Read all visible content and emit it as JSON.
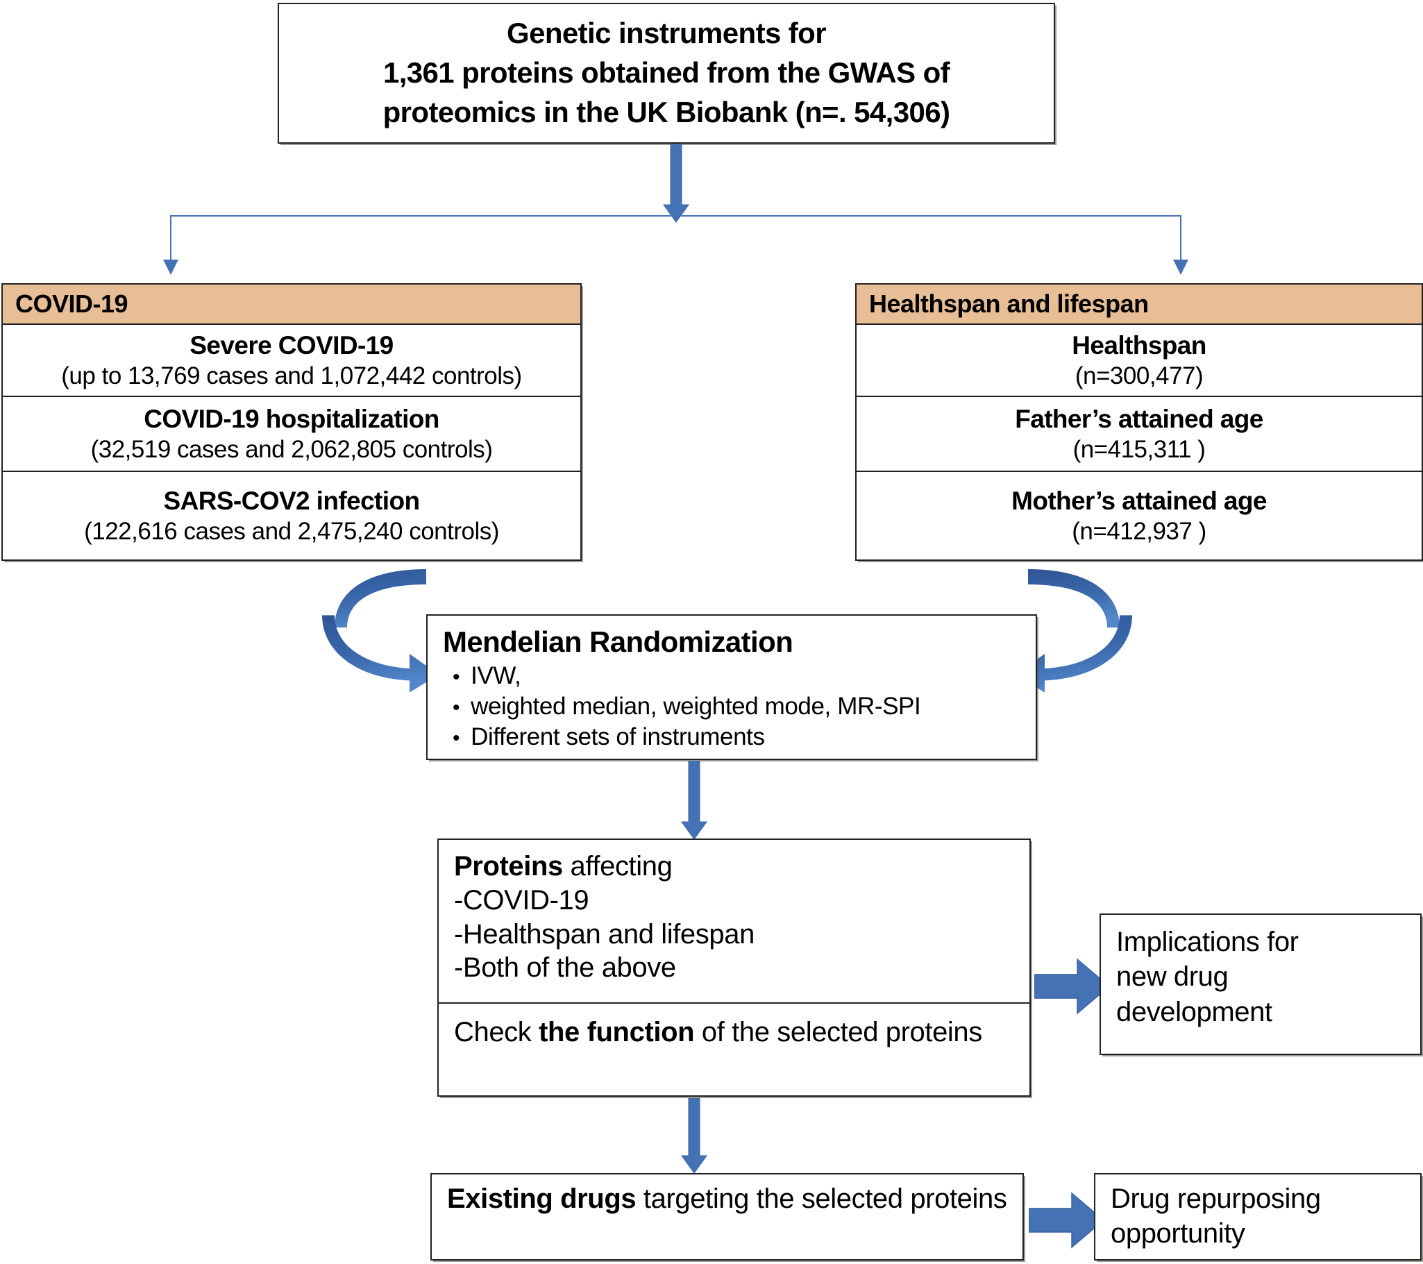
{
  "diagram": {
    "title_box": {
      "line1": "Genetic instruments for",
      "line2": "1,361 proteins obtained from the GWAS of",
      "line3": "proteomics in the UK Biobank (n=. 54,306)"
    },
    "covid_panel": {
      "header": "COVID-19",
      "rows": [
        {
          "title": "Severe COVID-19",
          "sub": "(up to 13,769 cases and 1,072,442 controls)"
        },
        {
          "title": "COVID-19 hospitalization",
          "sub": "(32,519 cases and 2,062,805 controls)"
        },
        {
          "title": "SARS-COV2 infection",
          "sub": "(122,616 cases and 2,475,240 controls)"
        }
      ]
    },
    "lifespan_panel": {
      "header": "Healthspan and lifespan",
      "rows": [
        {
          "title": "Healthspan",
          "sub": "(n=300,477)"
        },
        {
          "title": "Father’s attained age",
          "sub": "(n=415,311  )"
        },
        {
          "title": "Mother’s attained age",
          "sub": "(n=412,937  )"
        }
      ]
    },
    "mr_box": {
      "title": "Mendelian Randomization",
      "bullets": [
        "IVW,",
        "weighted median, weighted mode, MR-SPI",
        "Different sets of instruments"
      ]
    },
    "proteins_box": {
      "line1_bold": "Proteins",
      "line1_rest": " affecting",
      "line2": "-COVID-19",
      "line3": "-Healthspan  and lifespan",
      "line4": "-Both of the above",
      "check_pre": "Check ",
      "check_bold": "the function",
      "check_post": " of the selected proteins"
    },
    "implications_box": {
      "line1": "Implications for",
      "line2": "new drug",
      "line3": "development"
    },
    "drugs_box": {
      "bold": "Existing drugs",
      "rest": " targeting the selected proteins"
    },
    "repurposing_box": {
      "line1": "Drug repurposing",
      "line2": "opportunity"
    },
    "colors": {
      "panel_header_fill": "#E8BE96",
      "arrow_blue": "#4472B4",
      "curved_arrow_dark": "#2E5596",
      "curved_arrow_light": "#4E82C4",
      "box_border": "#222222"
    }
  }
}
